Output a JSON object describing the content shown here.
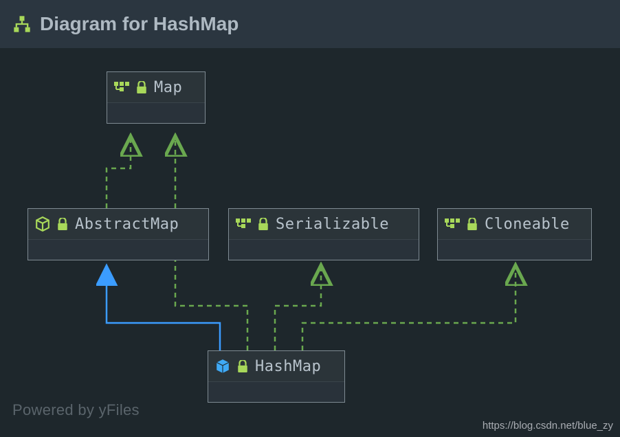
{
  "header": {
    "title": "Diagram for HashMap"
  },
  "nodes": {
    "map": {
      "label": "Map",
      "type": "interface"
    },
    "abstractMap": {
      "label": "AbstractMap",
      "type": "abstract-class"
    },
    "serializable": {
      "label": "Serializable",
      "type": "interface"
    },
    "cloneable": {
      "label": "Cloneable",
      "type": "interface"
    },
    "hashmap": {
      "label": "HashMap",
      "type": "class"
    }
  },
  "edges": [
    {
      "from": "AbstractMap",
      "to": "Map",
      "style": "implements"
    },
    {
      "from": "HashMap",
      "to": "Map",
      "style": "implements"
    },
    {
      "from": "HashMap",
      "to": "AbstractMap",
      "style": "extends"
    },
    {
      "from": "HashMap",
      "to": "Serializable",
      "style": "implements"
    },
    {
      "from": "HashMap",
      "to": "Cloneable",
      "style": "implements"
    }
  ],
  "footer": {
    "powered": "Powered by yFiles",
    "url": "https://blog.csdn.net/blue_zy"
  },
  "colors": {
    "implements": "#6aa84f",
    "extends": "#3b9cff",
    "iconGreen": "#a8d85a",
    "iconBlue": "#3fa9f5"
  }
}
